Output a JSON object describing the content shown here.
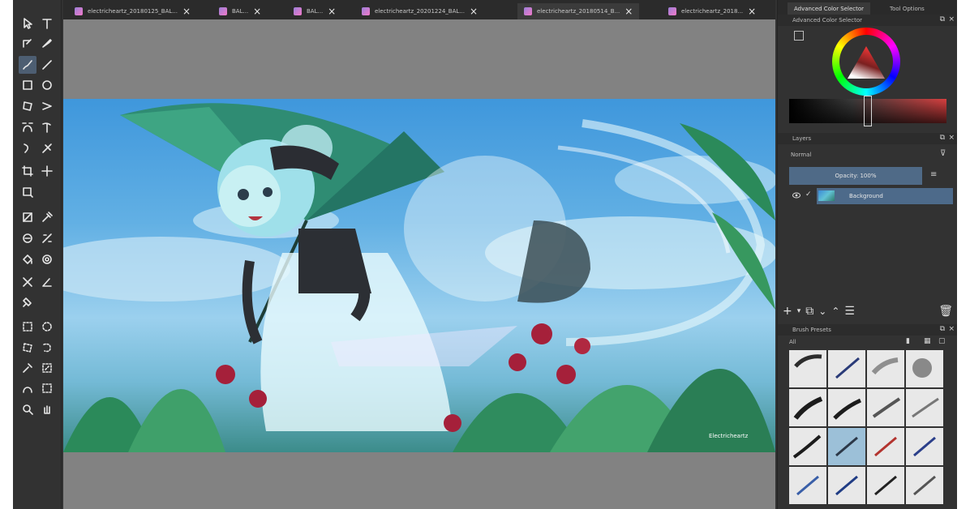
{
  "tabs": [
    {
      "label": "electricheartz_20180125_BAL..."
    },
    {
      "label": "BAL..."
    },
    {
      "label": "BAL..."
    },
    {
      "label": "electricheartz_20201224_BAL..."
    },
    {
      "label": "electricheartz_20180514_B..."
    },
    {
      "label": "electricheartz_2018..."
    }
  ],
  "dock": {
    "tabs": [
      "Advanced Color Selector",
      "Tool Options"
    ],
    "selector_title": "Advanced Color Selector",
    "layers_title": "Layers",
    "blend_mode": "Normal",
    "opacity_label": "Opacity: 100%",
    "layer_name": "Background",
    "presets_title": "Brush Presets",
    "presets_filter": "All"
  },
  "colors": {
    "accent": "#4d6a8a",
    "canvas_bg": "#828282",
    "ui_bg": "#323232"
  },
  "artwork": {
    "signature": "Electricheartz"
  }
}
